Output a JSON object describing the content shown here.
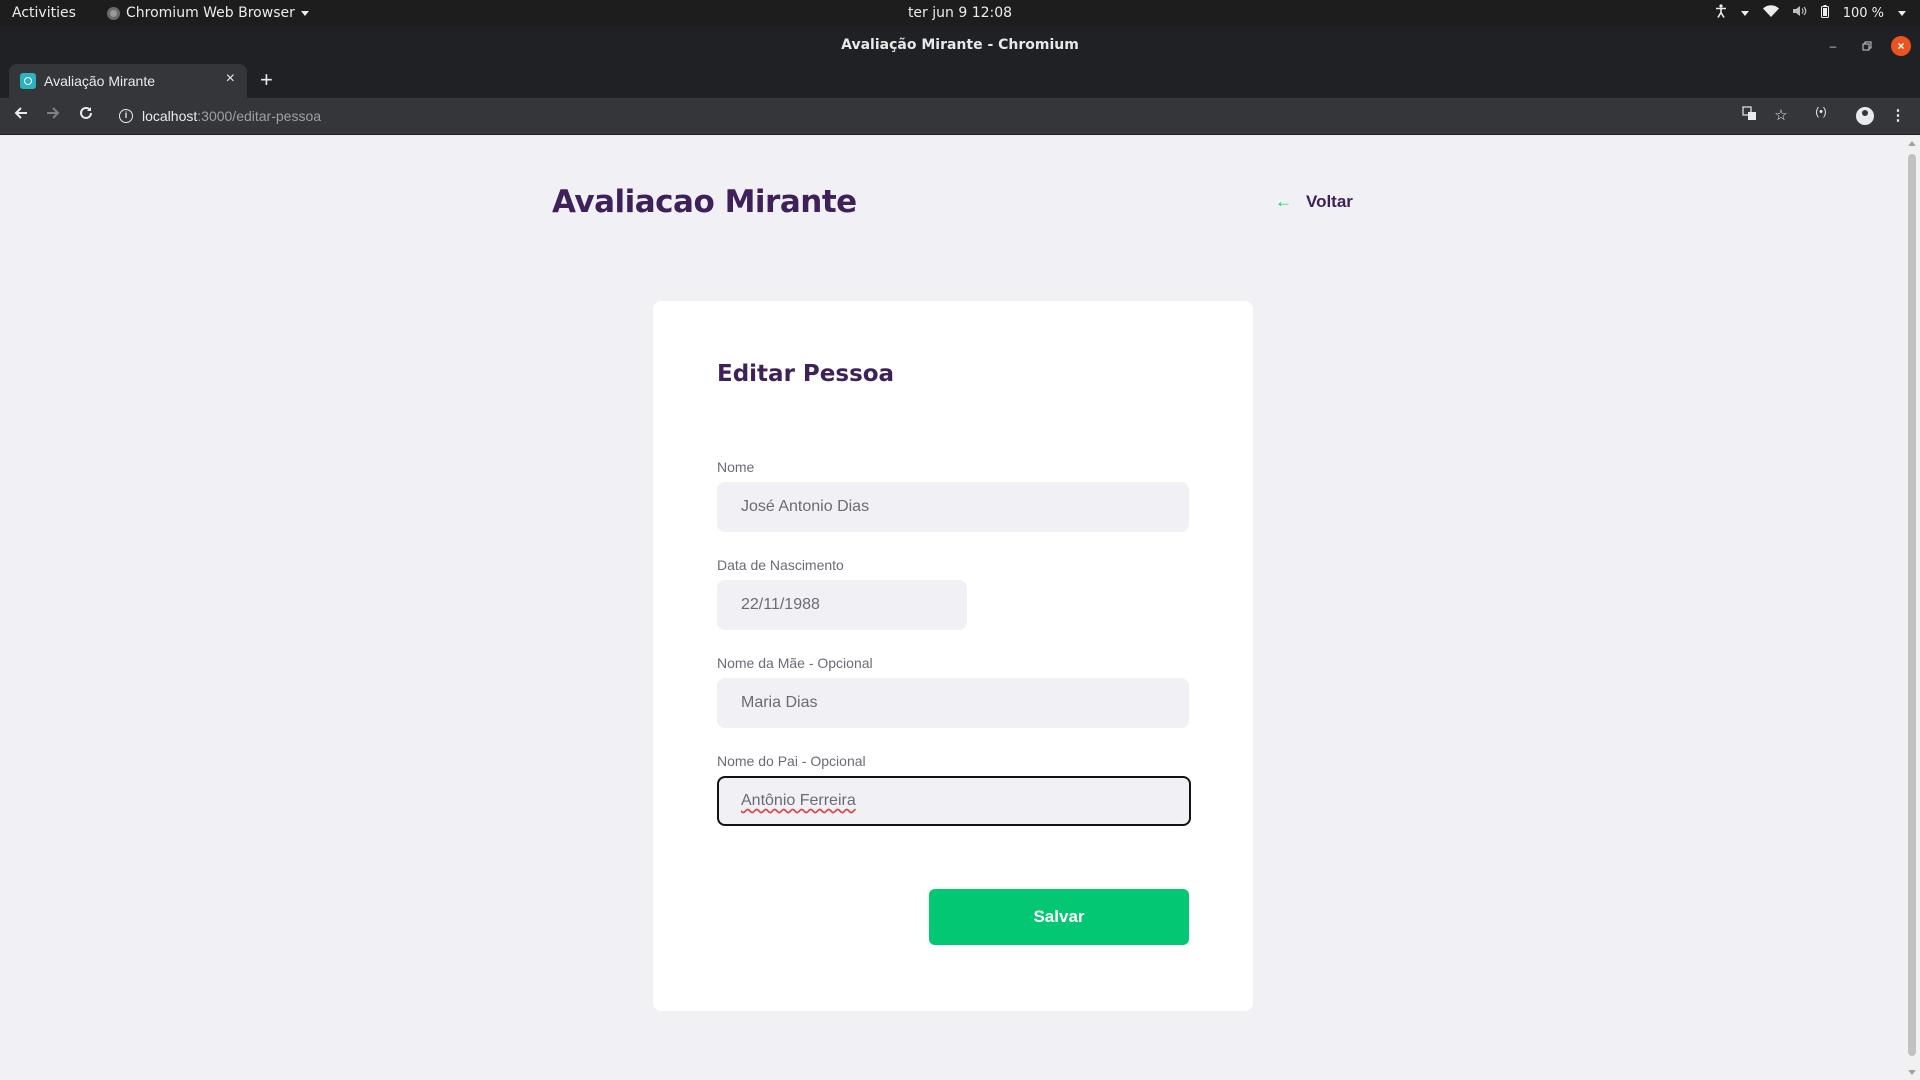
{
  "system": {
    "activities": "Activities",
    "app_menu": "Chromium Web Browser",
    "clock": "ter jun 9  12:08",
    "battery": "100 %"
  },
  "window": {
    "title": "Avaliação Mirante - Chromium"
  },
  "tab": {
    "label": "Avaliação Mirante",
    "close": "×",
    "new_tab": "+"
  },
  "address": {
    "host": "localhost",
    "path": ":3000/editar-pessoa"
  },
  "header": {
    "app_title": "Avaliacao Mirante",
    "back_arrow": "←",
    "back_label": "Voltar"
  },
  "form": {
    "title": "Editar Pessoa",
    "fields": [
      {
        "label": "Nome",
        "value": "José Antonio Dias"
      },
      {
        "label": "Data de Nascimento",
        "value": "22/11/1988"
      },
      {
        "label": "Nome da Mãe - Opcional",
        "value": "Maria Dias"
      },
      {
        "label": "Nome do Pai - Opcional",
        "value": "Antônio Ferreira",
        "focused": true
      }
    ],
    "save_label": "Salvar"
  },
  "colors": {
    "accent": "#04c774",
    "title": "#3d2158",
    "background": "#f0f0f5"
  },
  "icons": [
    "chromium-icon",
    "accessibility-icon",
    "wifi-icon",
    "volume-icon",
    "battery-icon",
    "back-icon",
    "forward-icon",
    "reload-icon",
    "info-icon",
    "translate-icon",
    "star-icon",
    "cast-icon",
    "account-icon",
    "menu-icon",
    "arrow-left-icon"
  ]
}
